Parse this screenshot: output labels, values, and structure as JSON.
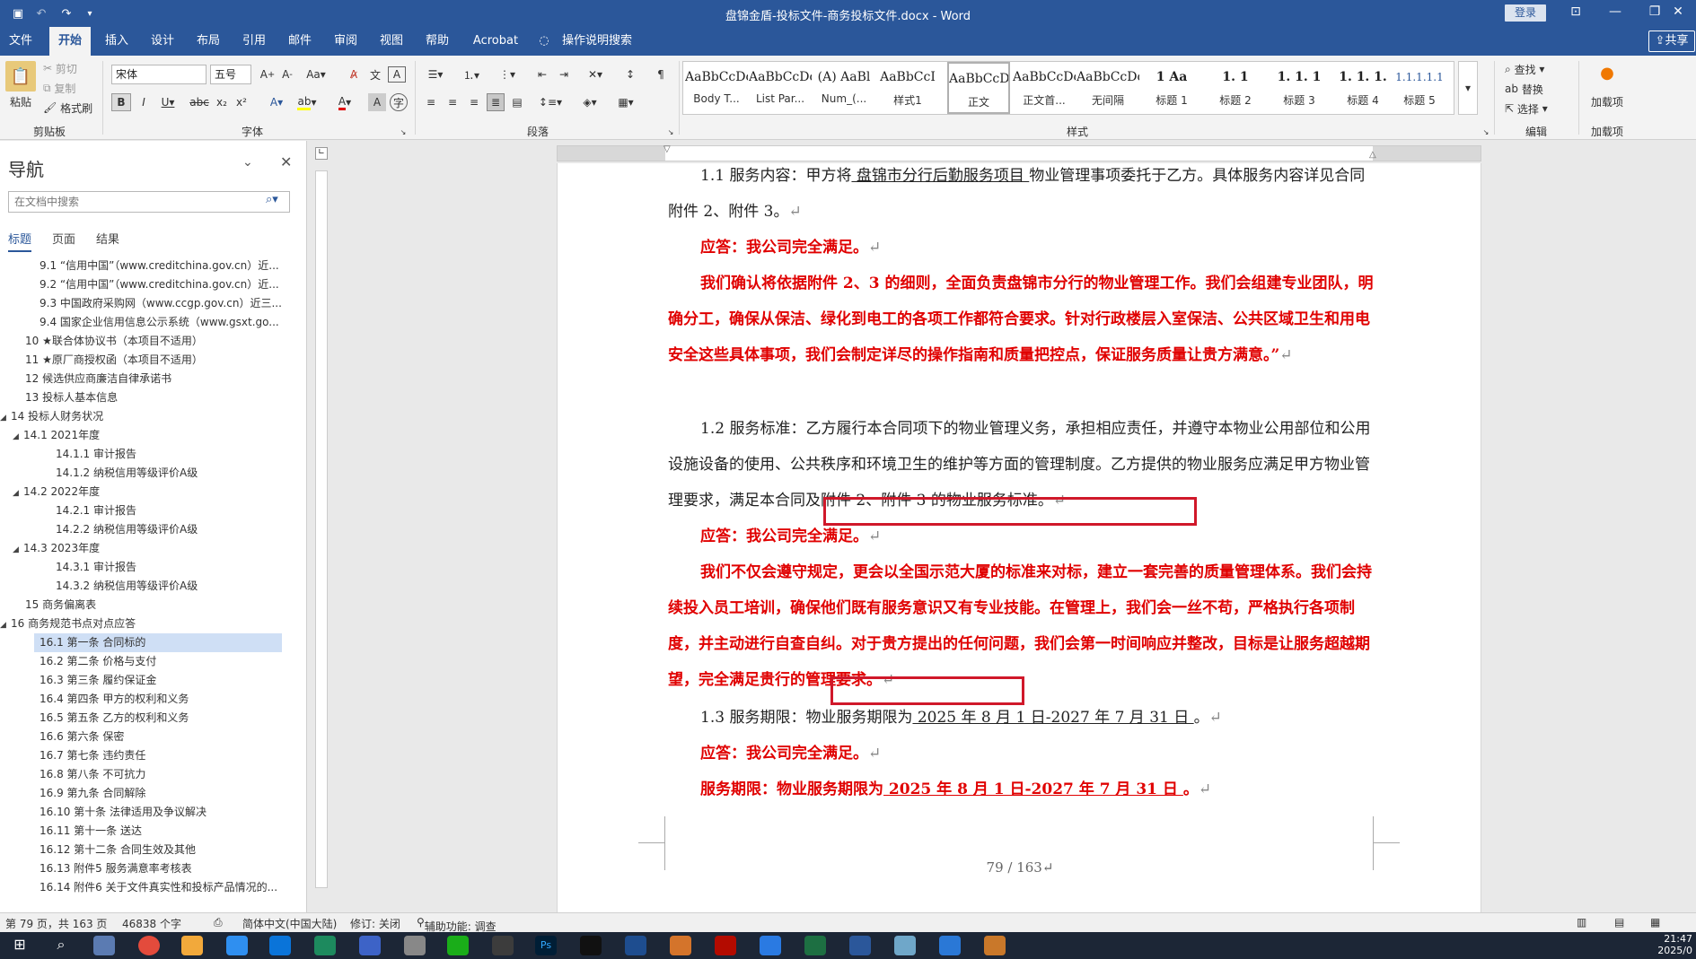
{
  "window": {
    "title": "盘锦金盾-投标文件-商务投标文件.docx  -  Word",
    "login": "登录"
  },
  "tabs": [
    "文件",
    "开始",
    "插入",
    "设计",
    "布局",
    "引用",
    "邮件",
    "审阅",
    "视图",
    "帮助",
    "Acrobat",
    "操作说明搜索"
  ],
  "share": "共享",
  "ribbon": {
    "clipboard": {
      "paste": "粘贴",
      "cut": "剪切",
      "copy": "复制",
      "format_painter": "格式刷",
      "label": "剪贴板"
    },
    "font": {
      "name": "宋体",
      "size": "五号",
      "label": "字体"
    },
    "paragraph": {
      "label": "段落"
    },
    "styles": {
      "label": "样式",
      "items": [
        {
          "preview": "AaBbCcDc",
          "name": "Body T..."
        },
        {
          "preview": "AaBbCcDc",
          "name": "List Par..."
        },
        {
          "preview": "(A) AaBl",
          "name": "Num_(..."
        },
        {
          "preview": "AaBbCcI",
          "name": "样式1"
        },
        {
          "preview": "AaBbCcDc",
          "name": "正文"
        },
        {
          "preview": "AaBbCcDc",
          "name": "正文首..."
        },
        {
          "preview": "AaBbCcDc",
          "name": "无间隔"
        },
        {
          "preview": "1  Aa",
          "name": "标题 1"
        },
        {
          "preview": "1. 1",
          "name": "标题 2"
        },
        {
          "preview": "1. 1. 1",
          "name": "标题 3"
        },
        {
          "preview": "1. 1. 1.",
          "name": "标题 4"
        },
        {
          "preview": "1.1.1.1.1",
          "name": "标题 5"
        }
      ]
    },
    "editing": {
      "find": "查找",
      "replace": "替换",
      "select": "选择",
      "label": "编辑"
    },
    "addins": {
      "button": "加载项",
      "label": "加载项"
    }
  },
  "nav": {
    "title": "导航",
    "search_placeholder": "在文档中搜索",
    "tabs": [
      "标题",
      "页面",
      "结果"
    ],
    "items": [
      {
        "text": "9.1 “信用中国”（www.creditchina.gov.cn）近...",
        "level": 3
      },
      {
        "text": "9.2 “信用中国”（www.creditchina.gov.cn）近...",
        "level": 3
      },
      {
        "text": "9.3 中国政府采购网（www.ccgp.gov.cn）近三...",
        "level": 3
      },
      {
        "text": "9.4 国家企业信用信息公示系统（www.gsxt.go...",
        "level": 3
      },
      {
        "text": "10 ★联合体协议书（本项目不适用）",
        "level": 2
      },
      {
        "text": "11 ★原厂商授权函（本项目不适用）",
        "level": 2
      },
      {
        "text": "12 候选供应商廉洁自律承诺书",
        "level": 2
      },
      {
        "text": "13 投标人基本信息",
        "level": 2
      },
      {
        "text": "14 投标人财务状况",
        "level": 1,
        "expanded": true
      },
      {
        "text": "14.1 2021年度",
        "level": 2,
        "expanded": true
      },
      {
        "text": "14.1.1 审计报告",
        "level": 4
      },
      {
        "text": "14.1.2 纳税信用等级评价A级",
        "level": 4
      },
      {
        "text": "14.2 2022年度",
        "level": 2,
        "expanded": true
      },
      {
        "text": "14.2.1 审计报告",
        "level": 4
      },
      {
        "text": "14.2.2 纳税信用等级评价A级",
        "level": 4
      },
      {
        "text": "14.3 2023年度",
        "level": 2,
        "expanded": true
      },
      {
        "text": "14.3.1 审计报告",
        "level": 4
      },
      {
        "text": "14.3.2 纳税信用等级评价A级",
        "level": 4
      },
      {
        "text": "15 商务偏离表",
        "level": 2
      },
      {
        "text": "16 商务规范书点对点应答",
        "level": 1,
        "expanded": true
      },
      {
        "text": "16.1 第一条 合同标的",
        "level": 3,
        "selected": true
      },
      {
        "text": "16.2 第二条 价格与支付",
        "level": 3
      },
      {
        "text": "16.3 第三条 履约保证金",
        "level": 3
      },
      {
        "text": "16.4 第四条 甲方的权利和义务",
        "level": 3
      },
      {
        "text": "16.5 第五条 乙方的权利和义务",
        "level": 3
      },
      {
        "text": "16.6 第六条 保密",
        "level": 3
      },
      {
        "text": "16.7 第七条 违约责任",
        "level": 3
      },
      {
        "text": "16.8 第八条 不可抗力",
        "level": 3
      },
      {
        "text": "16.9 第九条 合同解除",
        "level": 3
      },
      {
        "text": "16.10 第十条 法律适用及争议解决",
        "level": 3
      },
      {
        "text": "16.11 第十一条 送达",
        "level": 3
      },
      {
        "text": "16.12 第十二条 合同生效及其他",
        "level": 3
      },
      {
        "text": "16.13 附件5 服务满意率考核表",
        "level": 3
      },
      {
        "text": "16.14 附件6 关于文件真实性和投标产品情况的...",
        "level": 3
      }
    ]
  },
  "doc": {
    "p1": {
      "a": "1.1 服务内容：甲方将",
      "u": " 盘锦市分行后勤服务项目 ",
      "b": "物业管理事项委托于乙方。具体服务内容详见合同附件 2、附件 3。"
    },
    "r1": "应答：我公司完全满足。",
    "r2": "我们确认将依据附件 2、3 的细则，全面负责盘锦市分行的物业管理工作。我们会组建专业团队，明确分工，确保从保洁、绿化到电工的各项工作都符合要求。针对行政楼层入室保洁、公共区域卫生和用电安全这些具体事项，我们会制定详尽的操作指南和质量把控点，保证服务质量让贵方满意。”",
    "p2": {
      "a": "1.2 服务标准：乙方履行本合同项下的物业管理义务，承担相应责任，并遵守本物业公用部位和公用设施设备的使用、公共秩序和环境卫生的维护等方面的管理制度。乙方提供的物业服务应满足甲方物业管理要求，",
      "b": "满足本合同及附件 2、附件 3 的物业服务标准。"
    },
    "r3": "应答：我公司完全满足。",
    "r4": {
      "a": "我们不仅会遵守规定，更会以全国示范大厦的标准来对标，建立一套完善的质量管理体系。我们会持续投入员工培训，确保他们既有服务意识又有专业技能。在管理上，我们会一丝不苟，严格执行各项制度，并主动进行自查自纠。对于贵方提出的任何问题，我们会第一时间响应并整改，目标是让服务超越期望，",
      "b": "完全满足贵行的管理要求。"
    },
    "p3": {
      "a": "1.3 服务期限：物业服务期限为",
      "u": " 2025 年 8 月 1 日-2027 年 7 月 31 日 ",
      "b": "。"
    },
    "r5": "应答：我公司完全满足。",
    "r6": {
      "a": "服务期限：物业服务期限为",
      "u": " 2025 年 8 月 1 日-2027 年 7 月 31 日 ",
      "b": "。"
    },
    "mark": "↵",
    "page_no": "79 / 163↵"
  },
  "status": {
    "page": "第 79 页，共 163 页",
    "words": "46838 个字",
    "lang": "简体中文(中国大陆)",
    "track": "修订: 关闭",
    "access": "辅助功能: 调查"
  },
  "clock": {
    "time": "21:47",
    "date": "2025/0"
  },
  "accent": "#2b579a",
  "red": "#e00000"
}
